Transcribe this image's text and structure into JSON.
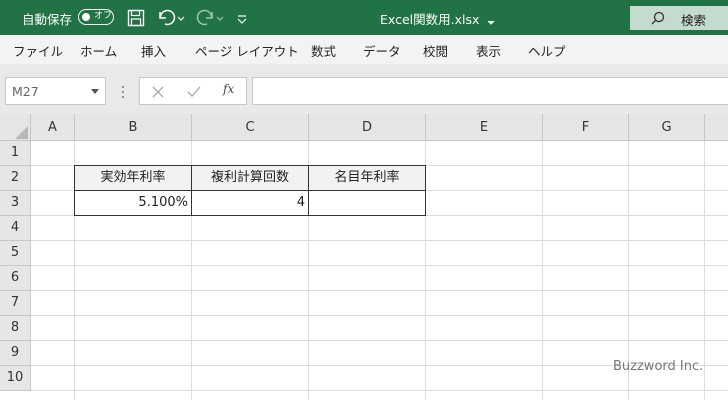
{
  "titlebar": {
    "autosave_label": "自動保存",
    "autosave_state": "オフ",
    "doc_title": "Excel関数用.xlsx",
    "search_label": "検索"
  },
  "ribbon": {
    "tabs": [
      "ファイル",
      "ホーム",
      "挿入",
      "ページ レイアウト",
      "数式",
      "データ",
      "校閲",
      "表示",
      "ヘルプ"
    ]
  },
  "formula_bar": {
    "name_box": "M27",
    "fx_symbol": "fx",
    "formula": ""
  },
  "sheet": {
    "columns": [
      "A",
      "B",
      "C",
      "D",
      "E",
      "F",
      "G"
    ],
    "rows": [
      "1",
      "2",
      "3",
      "4",
      "5",
      "6",
      "7",
      "8",
      "9",
      "10"
    ],
    "headers": {
      "B2": "実効年利率",
      "C2": "複利計算回数",
      "D2": "名目年利率"
    },
    "values": {
      "B3": "5.100%",
      "C3": "4",
      "D3": ""
    }
  },
  "watermark": "Buzzword Inc."
}
